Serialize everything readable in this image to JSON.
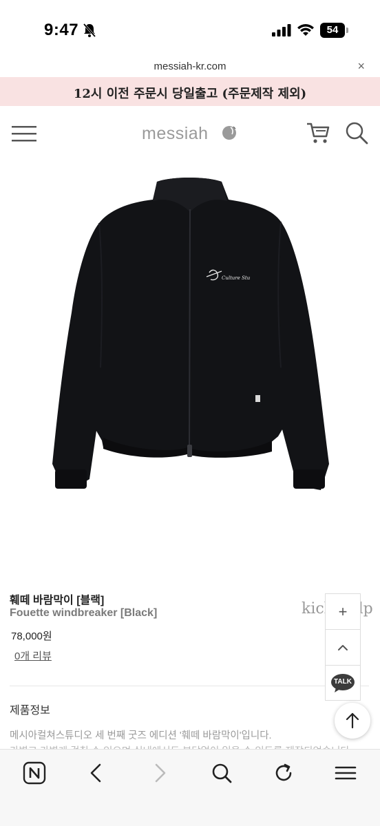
{
  "status_bar": {
    "time": "9:47",
    "battery": "54"
  },
  "browser": {
    "url": "messiah-kr.com",
    "close_label": "×"
  },
  "banner": {
    "text": "12시 이전 주문시 당일출고 (주문제작 제외)"
  },
  "header": {
    "logo_text": "messiah"
  },
  "product": {
    "title": "훼떼 바람막이 [블랙]",
    "subtitle": "Fouette windbreaker [Black]",
    "price": "78,000원",
    "review_link": "0개 리뷰",
    "chest_logo_text": "Culture Stu"
  },
  "info": {
    "section_label": "제품정보",
    "description": "메시아컬쳐스튜디오 세 번째 굿즈 에디션 '훼떼 바람막이'입니다.",
    "description_cut": "가볍고 가볍게 걸칠 수 있으며 실내에서도 부담없이 입을 수 있도록 제작되었습니다."
  },
  "side_widget": {
    "plus_label": "+",
    "talk_label": "TALK"
  },
  "overflow_text": "kickerelp",
  "icons": {
    "bell": "bell-muted-icon",
    "signal": "signal-icon",
    "wifi": "wifi-icon",
    "menu": "hamburger-menu-icon",
    "cart": "cart-icon",
    "search": "search-icon",
    "up": "chevron-up-icon",
    "scroll_top": "arrow-up-icon",
    "naver": "naver-home-icon",
    "back": "back-arrow-icon",
    "forward": "forward-arrow-icon",
    "refresh": "refresh-icon",
    "more": "more-menu-icon"
  },
  "colors": {
    "banner_bg": "#f9e2e2",
    "logo_gray": "#9a9a9a",
    "talk_bubble": "#3c3c3c",
    "jacket": "#111214"
  }
}
